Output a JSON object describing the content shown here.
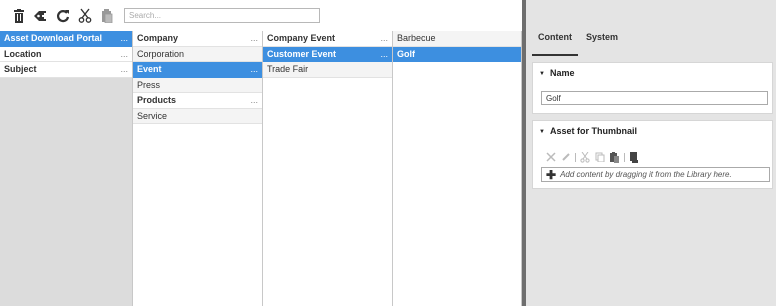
{
  "toolbar": {
    "icons": [
      "trash-icon",
      "tag-add-icon",
      "refresh-icon",
      "cut-icon",
      "paste-icon"
    ],
    "search_placeholder": "Search..."
  },
  "columns": [
    {
      "items": [
        {
          "label": "Asset Download Portal",
          "more": "...",
          "selected": true
        },
        {
          "label": "Location",
          "more": "...",
          "bold": true
        },
        {
          "label": "Subject",
          "more": "...",
          "bold": true
        }
      ]
    },
    {
      "items": [
        {
          "label": "Company",
          "more": "...",
          "bold": true
        },
        {
          "label": "Corporation"
        },
        {
          "label": "Event",
          "more": "...",
          "selected": true
        },
        {
          "label": "Press"
        },
        {
          "label": "Products",
          "more": "...",
          "bold": true
        },
        {
          "label": "Service"
        }
      ]
    },
    {
      "items": [
        {
          "label": "Company Event",
          "more": "...",
          "bold": true
        },
        {
          "label": "Customer Event",
          "more": "...",
          "selected": true
        },
        {
          "label": "Trade Fair"
        }
      ]
    },
    {
      "items": [
        {
          "label": "Barbecue"
        },
        {
          "label": "Golf",
          "selected": true
        }
      ]
    }
  ],
  "right_panel": {
    "tabs": [
      {
        "label": "Content",
        "active": true
      },
      {
        "label": "System"
      }
    ],
    "name_section": {
      "title": "Name",
      "value": "Golf"
    },
    "thumbnail_section": {
      "title": "Asset for Thumbnail",
      "dropzone_text": "Add content by dragging it from the Library here."
    }
  },
  "colors": {
    "selection": "#3d8fe0",
    "splitter": "#6e6e6e",
    "panel_bg": "#e4e4e4"
  }
}
